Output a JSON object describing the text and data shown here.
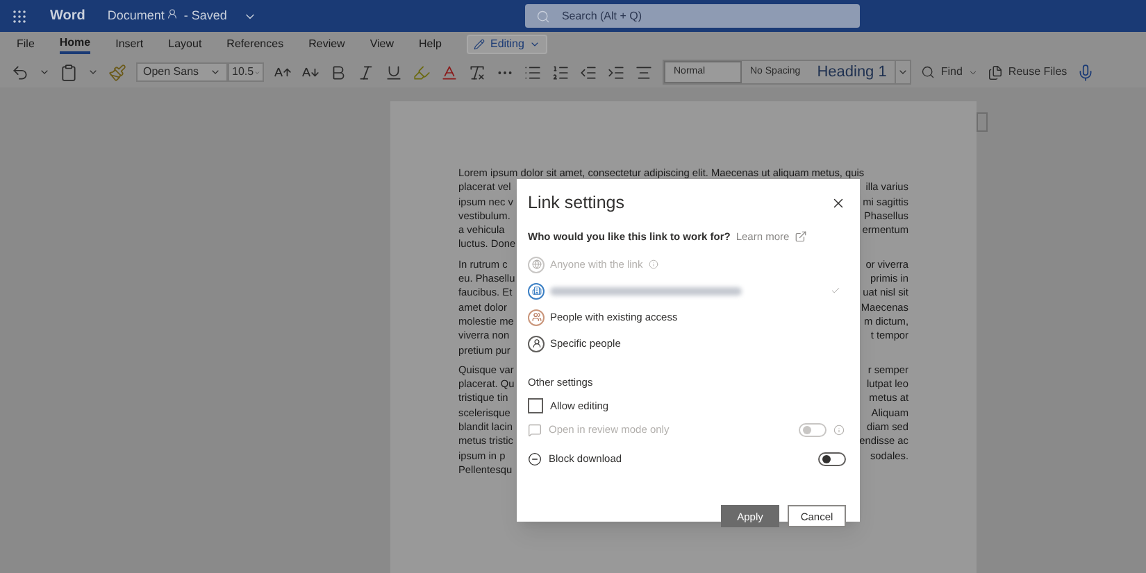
{
  "title_bar": {
    "app": "Word",
    "document": "Document",
    "status": "- Saved",
    "search": {
      "placeholder": "Search (Alt + Q)"
    }
  },
  "menu_tabs": [
    {
      "label": "File",
      "selected": false
    },
    {
      "label": "Home",
      "selected": true
    },
    {
      "label": "Insert",
      "selected": false
    },
    {
      "label": "Layout",
      "selected": false
    },
    {
      "label": "References",
      "selected": false
    },
    {
      "label": "Review",
      "selected": false
    },
    {
      "label": "View",
      "selected": false
    },
    {
      "label": "Help",
      "selected": false
    }
  ],
  "mode_button": "Editing",
  "toolbar": {
    "font": "Open Sans",
    "size": "10.5",
    "styles": [
      {
        "label": "Normal",
        "selected": true,
        "kind": "plain"
      },
      {
        "label": "No Spacing",
        "selected": false,
        "kind": "plain"
      },
      {
        "label": "Heading 1",
        "selected": false,
        "kind": "heading"
      }
    ],
    "find": "Find",
    "reuse": "Reuse Files"
  },
  "document": {
    "paragraphs": [
      {
        "lines": [
          {
            "left": "Lorem ipsum dolor sit amet, consectetur adipiscing elit. Maecenas ut aliquam metus, quis"
          },
          {
            "left": "placerat vel",
            "right": "illa varius"
          },
          {
            "left": "ipsum nec v",
            "right": "mi sagittis"
          },
          {
            "left": "vestibulum.",
            "right": "Phasellus"
          },
          {
            "left": "a vehicula",
            "right": "ermentum"
          },
          {
            "left": "luctus. Done"
          }
        ]
      },
      {
        "lines": [
          {
            "left": "In rutrum c",
            "right": "or viverra"
          },
          {
            "left": "eu. Phasellu",
            "right": "primis in"
          },
          {
            "left": "faucibus. Et",
            "right": "uat nisl sit"
          },
          {
            "left": "amet dolor",
            "right": "Maecenas"
          },
          {
            "left": "molestie me",
            "right": "m dictum,"
          },
          {
            "left": "viverra non",
            "right": "t tempor"
          },
          {
            "left": "pretium pur"
          }
        ]
      },
      {
        "lines": [
          {
            "left": "Quisque var",
            "right": "r semper"
          },
          {
            "left": "placerat. Qu",
            "right": "lutpat leo"
          },
          {
            "left": "tristique tin",
            "right": "metus at"
          },
          {
            "left": "scelerisque",
            "right": "Aliquam"
          },
          {
            "left": "blandit lacin",
            "right": "diam sed"
          },
          {
            "left": "metus tristic",
            "right": "endisse ac"
          },
          {
            "left": "ipsum in p",
            "right": "sodales."
          },
          {
            "left": "Pellentesqu"
          }
        ]
      }
    ]
  },
  "dialog": {
    "title": "Link settings",
    "question": "Who would you like this link to work for?",
    "learn_more": "Learn more",
    "options": [
      {
        "kind": "globe",
        "label": "Anyone with the link",
        "disabled": true,
        "selected": false,
        "info": true
      },
      {
        "kind": "org",
        "disabled": false,
        "selected": true,
        "info": false
      },
      {
        "kind": "existing",
        "label": "People with existing access",
        "disabled": false,
        "selected": false,
        "info": false
      },
      {
        "kind": "specific",
        "label": "Specific people",
        "disabled": false,
        "selected": false,
        "info": false
      }
    ],
    "other_heading": "Other settings",
    "settings": [
      {
        "kind": "checkbox",
        "label": "Allow editing",
        "checked": false,
        "disabled": false
      },
      {
        "kind": "review",
        "label": "Open in review mode only",
        "on": false,
        "disabled": true
      },
      {
        "kind": "block",
        "label": "Block download",
        "on": false,
        "disabled": false
      }
    ],
    "buttons": [
      {
        "label": "Apply",
        "kind": "primary"
      },
      {
        "label": "Cancel",
        "kind": "secondary"
      }
    ]
  }
}
